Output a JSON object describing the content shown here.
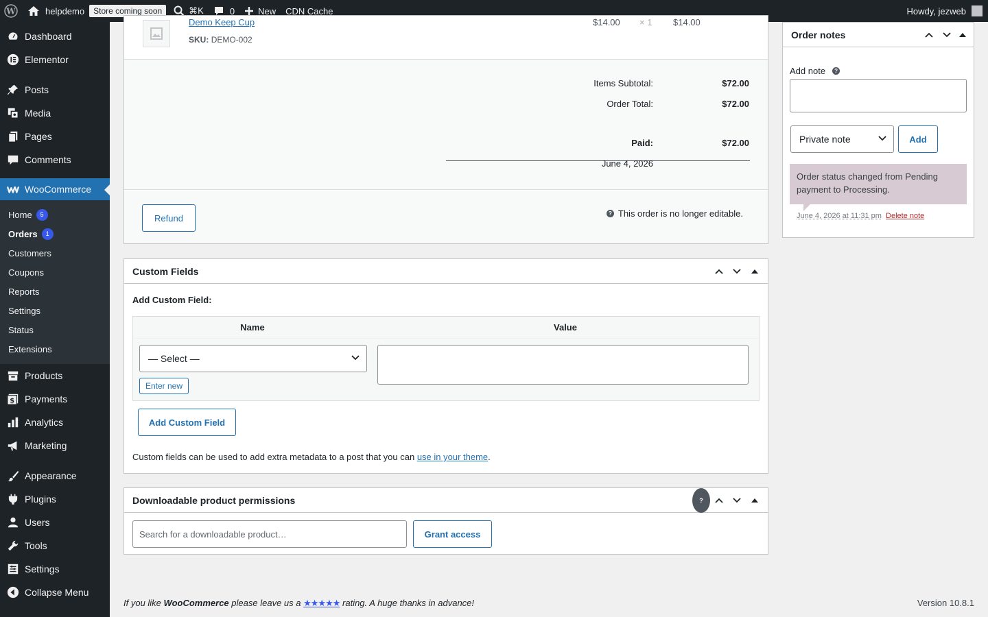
{
  "adminbar": {
    "site_name": "helpdemo",
    "store_badge": "Store coming soon",
    "search_shortcut": "⌘K",
    "comments_count": "0",
    "new_label": "New",
    "cdn_label": "CDN Cache",
    "howdy": "Howdy, jezweb"
  },
  "sidebar": {
    "items_top": [
      {
        "label": "Dashboard",
        "icon": "dashboard-icon"
      },
      {
        "label": "Elementor",
        "icon": "elementor-icon"
      }
    ],
    "items_mid": [
      {
        "label": "Posts",
        "icon": "pin-icon"
      },
      {
        "label": "Media",
        "icon": "media-icon"
      },
      {
        "label": "Pages",
        "icon": "pages-icon"
      },
      {
        "label": "Comments",
        "icon": "comment-icon"
      }
    ],
    "woocommerce": {
      "label": "WooCommerce",
      "icon": "woocommerce-icon"
    },
    "submenu": [
      {
        "label": "Home",
        "badge": "5"
      },
      {
        "label": "Orders",
        "badge": "1"
      },
      {
        "label": "Customers"
      },
      {
        "label": "Coupons"
      },
      {
        "label": "Reports"
      },
      {
        "label": "Settings"
      },
      {
        "label": "Status"
      },
      {
        "label": "Extensions"
      }
    ],
    "items_bottom": [
      {
        "label": "Products"
      },
      {
        "label": "Payments"
      },
      {
        "label": "Analytics"
      },
      {
        "label": "Marketing"
      },
      {
        "label": "Appearance"
      },
      {
        "label": "Plugins"
      },
      {
        "label": "Users"
      },
      {
        "label": "Tools"
      },
      {
        "label": "Settings"
      },
      {
        "label": "Collapse Menu"
      }
    ]
  },
  "order_item": {
    "name": "Demo Keep Cup",
    "sku_label": "SKU:",
    "sku": "DEMO-002",
    "price": "$14.00",
    "qty": "× 1",
    "total": "$14.00"
  },
  "totals": {
    "items_subtotal_label": "Items Subtotal:",
    "items_subtotal": "$72.00",
    "order_total_label": "Order Total:",
    "order_total": "$72.00",
    "paid_label": "Paid:",
    "paid": "$72.00",
    "paid_date": "June 4, 2026"
  },
  "refund": {
    "button": "Refund",
    "notice": "This order is no longer editable."
  },
  "custom_fields": {
    "title": "Custom Fields",
    "add_label": "Add Custom Field:",
    "col_name": "Name",
    "col_value": "Value",
    "select_value": "— Select —",
    "enter_new": "Enter new",
    "add_button": "Add Custom Field",
    "help_text": "Custom fields can be used to add extra metadata to a post that you can",
    "help_link": "use in your theme",
    "help_end": "."
  },
  "downloads": {
    "title": "Downloadable product permissions",
    "search_placeholder": "Search for a downloadable product…",
    "grant_button": "Grant access"
  },
  "order_notes": {
    "title": "Order notes",
    "add_note_label": "Add note",
    "note_type": "Private note",
    "add_button": "Add",
    "note_text": "Order status changed from Pending payment to Processing.",
    "note_date": "June 4, 2026 at 11:31 pm",
    "delete_link": "Delete note"
  },
  "footer": {
    "text_1": "If you like",
    "brand": "WooCommerce",
    "text_2": "please leave us a",
    "stars": "★★★★★",
    "text_3": "rating. A huge thanks in advance!",
    "version": "Version 10.8.1"
  }
}
